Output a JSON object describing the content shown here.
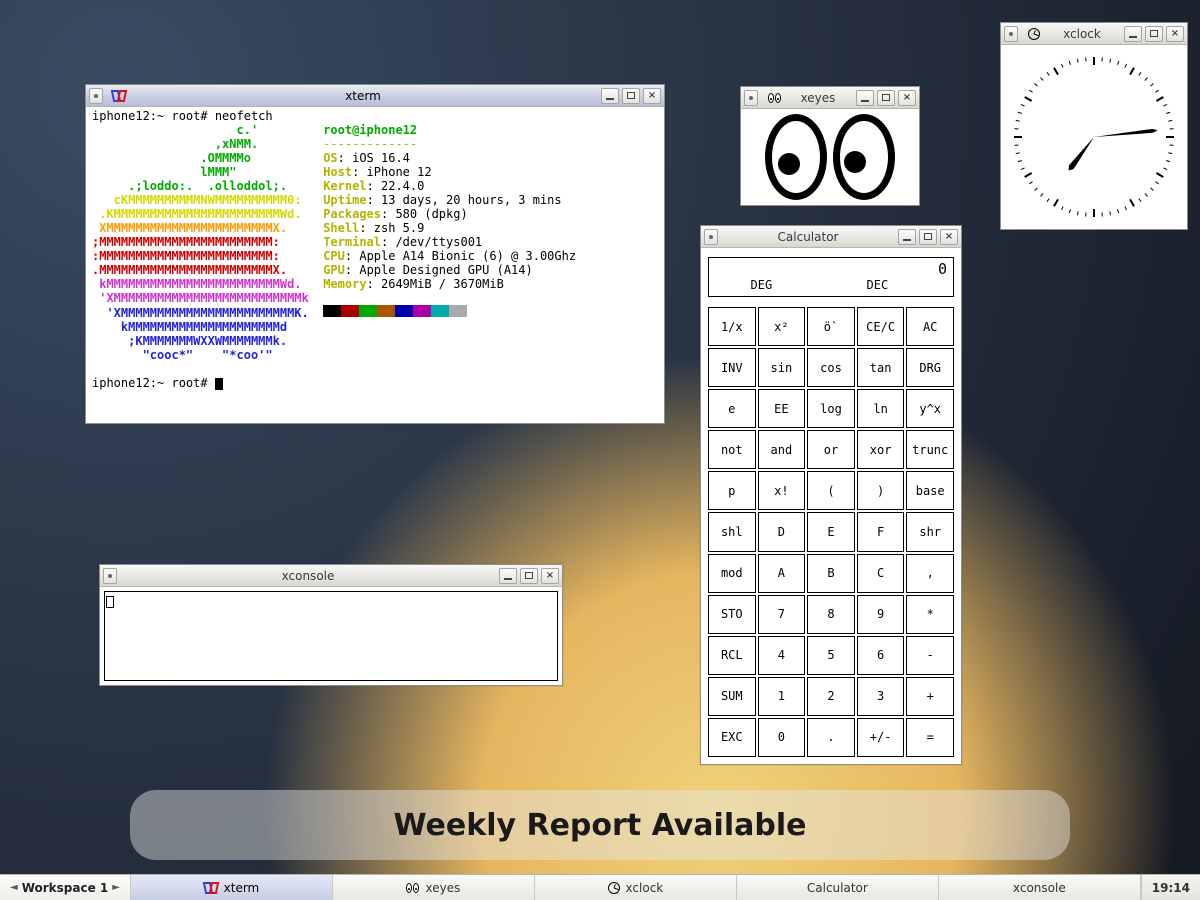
{
  "xterm": {
    "title": "xterm",
    "prompt1": "iphone12:~ root# ",
    "command": "neofetch",
    "prompt2": "iphone12:~ root# ",
    "neofetch": {
      "userhost": "root@iphone12",
      "divider": "-------------",
      "ascii": [
        {
          "cls": "nf-green",
          "txt": "                    c.'"
        },
        {
          "cls": "nf-green",
          "txt": "                 ,xNMM."
        },
        {
          "cls": "nf-green",
          "txt": "               .OMMMMo"
        },
        {
          "cls": "nf-green",
          "txt": "               lMMM\""
        },
        {
          "cls": "nf-green",
          "txt": "     .;loddo:.  .olloddol;."
        },
        {
          "cls": "nf-yellow",
          "txt": "   cKMMMMMMMMMMNWMMMMMMMMMM0:"
        },
        {
          "cls": "nf-yellow",
          "txt": " .KMMMMMMMMMMMMMMMMMMMMMMMWd."
        },
        {
          "cls": "nf-orange",
          "txt": " XMMMMMMMMMMMMMMMMMMMMMMMX."
        },
        {
          "cls": "nf-red",
          "txt": ";MMMMMMMMMMMMMMMMMMMMMMMM:"
        },
        {
          "cls": "nf-red",
          "txt": ":MMMMMMMMMMMMMMMMMMMMMMMM:"
        },
        {
          "cls": "nf-red",
          "txt": ".MMMMMMMMMMMMMMMMMMMMMMMMX."
        },
        {
          "cls": "nf-magenta",
          "txt": " kMMMMMMMMMMMMMMMMMMMMMMMMWd."
        },
        {
          "cls": "nf-magenta",
          "txt": " 'XMMMMMMMMMMMMMMMMMMMMMMMMMMk"
        },
        {
          "cls": "nf-blue",
          "txt": "  'XMMMMMMMMMMMMMMMMMMMMMMMMK."
        },
        {
          "cls": "nf-blue",
          "txt": "    kMMMMMMMMMMMMMMMMMMMMMd"
        },
        {
          "cls": "nf-blue",
          "txt": "     ;KMMMMMMMWXXWMMMMMMMk."
        },
        {
          "cls": "nf-blue",
          "txt": "       \"cooc*\"    \"*coo'\""
        }
      ],
      "info": [
        {
          "label": "OS",
          "val": "iOS 16.4"
        },
        {
          "label": "Host",
          "val": "iPhone 12"
        },
        {
          "label": "Kernel",
          "val": "22.4.0"
        },
        {
          "label": "Uptime",
          "val": "13 days, 20 hours, 3 mins"
        },
        {
          "label": "Packages",
          "val": "580 (dpkg)"
        },
        {
          "label": "Shell",
          "val": "zsh 5.9"
        },
        {
          "label": "Terminal",
          "val": "/dev/ttys001"
        },
        {
          "label": "CPU",
          "val": "Apple A14 Bionic (6) @ 3.00Ghz"
        },
        {
          "label": "GPU",
          "val": "Apple Designed GPU (A14)"
        },
        {
          "label": "Memory",
          "val": "2649MiB / 3670MiB"
        }
      ],
      "palette": [
        "#000000",
        "#aa0000",
        "#00aa00",
        "#aa5500",
        "#0000aa",
        "#aa00aa",
        "#00aaaa",
        "#aaaaaa",
        "#ffffff"
      ]
    }
  },
  "xeyes": {
    "title": "xeyes"
  },
  "xclock": {
    "title": "xclock"
  },
  "calculator": {
    "title": "Calculator",
    "display_value": "0",
    "mode_angle": "DEG",
    "mode_base": "DEC",
    "buttons": [
      "1/x",
      "x²",
      "ö`",
      "CE/C",
      "AC",
      "INV",
      "sin",
      "cos",
      "tan",
      "DRG",
      "e",
      "EE",
      "log",
      "ln",
      "y^x",
      "not",
      "and",
      "or",
      "xor",
      "trunc",
      "p",
      "x!",
      "(",
      ")",
      "base",
      "shl",
      "D",
      "E",
      "F",
      "shr",
      "mod",
      "A",
      "B",
      "C",
      ",",
      "STO",
      "7",
      "8",
      "9",
      "*",
      "RCL",
      "4",
      "5",
      "6",
      "-",
      "SUM",
      "1",
      "2",
      "3",
      "+",
      "EXC",
      "0",
      ".",
      "+/-",
      "="
    ]
  },
  "xconsole": {
    "title": "xconsole",
    "value": ""
  },
  "notification": {
    "headline": "Weekly Report Available"
  },
  "taskbar": {
    "workspace": "Workspace 1",
    "tasks": [
      {
        "id": "xterm",
        "label": "xterm",
        "active": true
      },
      {
        "id": "xeyes",
        "label": "xeyes",
        "active": false
      },
      {
        "id": "xclock",
        "label": "xclock",
        "active": false
      },
      {
        "id": "calculator",
        "label": "Calculator",
        "active": false
      },
      {
        "id": "xconsole",
        "label": "xconsole",
        "active": false
      }
    ],
    "clock": "19:14"
  }
}
